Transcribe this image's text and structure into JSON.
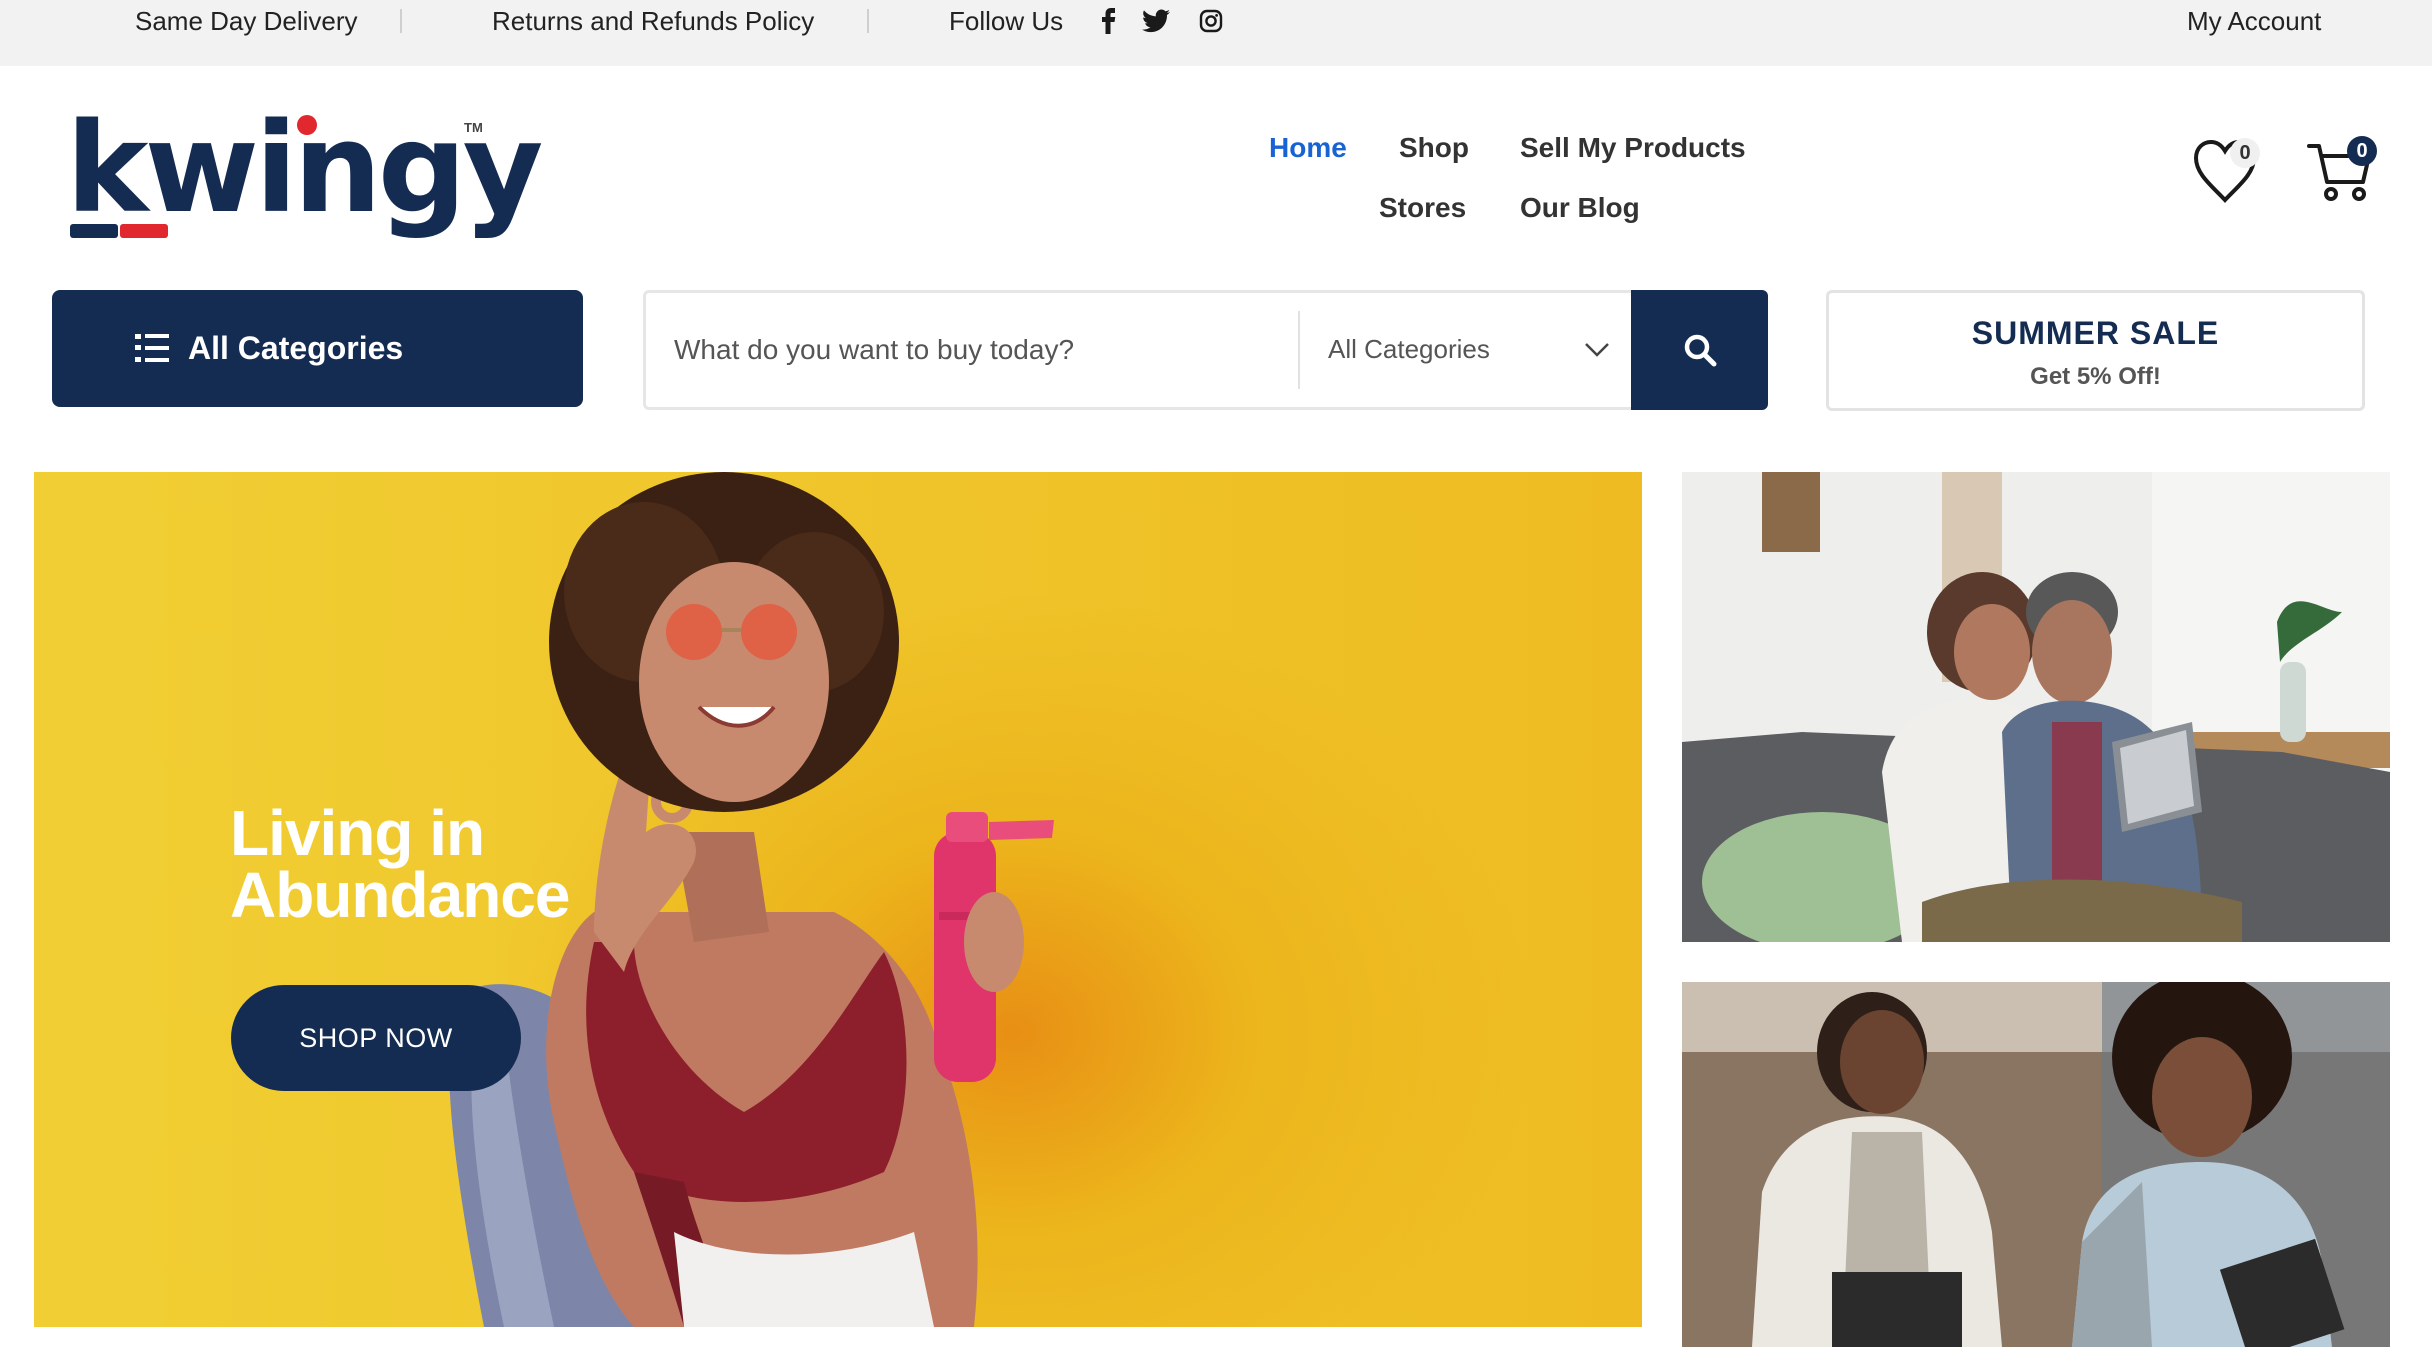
{
  "topbar": {
    "delivery": "Same Day Delivery",
    "returns": "Returns and Refunds Policy",
    "follow": "Follow Us",
    "account": "My Account",
    "social_icons": [
      "facebook-icon",
      "twitter-icon",
      "instagram-icon"
    ]
  },
  "brand": {
    "name": "kwingy",
    "tm": "TM",
    "primary_color": "#152c52",
    "accent_color": "#e0282e"
  },
  "nav": {
    "home": "Home",
    "shop": "Shop",
    "sell": "Sell My Products",
    "stores": "Stores",
    "blog": "Our Blog",
    "active_color": "#1863d4"
  },
  "header": {
    "wishlist_count": "0",
    "cart_count": "0"
  },
  "search": {
    "all_categories_button": "All Categories",
    "placeholder": "What do you want to buy today?",
    "category_select": "All Categories"
  },
  "promo": {
    "title": "SUMMER SALE",
    "subtitle": "Get 5% Off!"
  },
  "hero": {
    "title_line1": "Living in",
    "title_line2": "Abundance",
    "cta": "SHOP NOW"
  }
}
